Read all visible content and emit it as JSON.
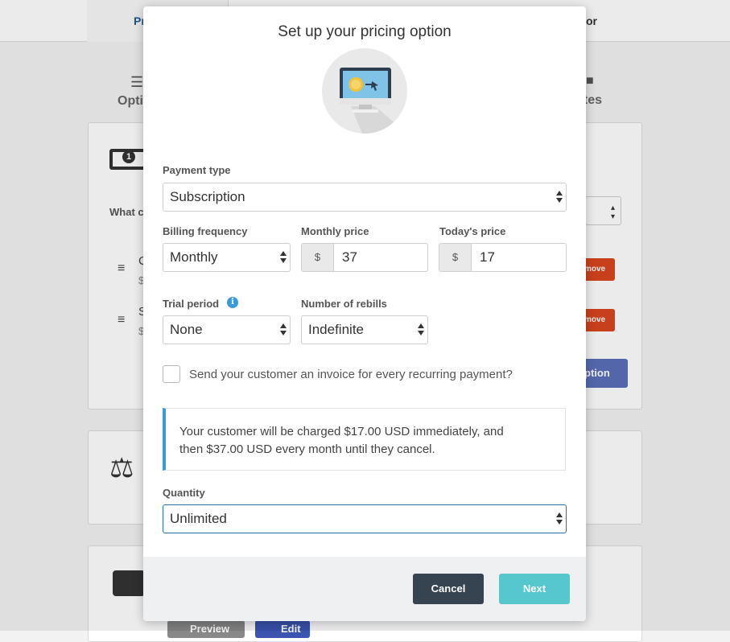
{
  "background": {
    "tab_left": "Pr",
    "tab_right": "or",
    "step_left": "Optio",
    "step_right": "ates",
    "what_text": "What c",
    "row1_letter": "C",
    "row1_price": "$",
    "row2_letter": "S",
    "row2_price": "$",
    "remove_label": "move",
    "add_option_label": "ption",
    "preview_label": "Preview",
    "edit_label": "Edit"
  },
  "modal": {
    "title": "Set up your pricing option",
    "hero_icon": "computer-payment-icon",
    "payment_type": {
      "label": "Payment type",
      "value": "Subscription"
    },
    "billing_frequency": {
      "label": "Billing frequency",
      "value": "Monthly"
    },
    "monthly_price": {
      "label": "Monthly price",
      "currency": "$",
      "value": "37"
    },
    "todays_price": {
      "label": "Today's price",
      "currency": "$",
      "value": "17"
    },
    "trial_period": {
      "label": "Trial period",
      "value": "None",
      "info_icon": "i"
    },
    "rebills": {
      "label": "Number of rebills",
      "value": "Indefinite"
    },
    "invoice_checkbox": {
      "label": "Send your customer an invoice for every recurring payment?",
      "checked": false
    },
    "notice": {
      "line1": "Your customer will be charged $17.00 USD immediately, and",
      "line2": "then $37.00 USD every month until they cancel."
    },
    "quantity": {
      "label": "Quantity",
      "value": "Unlimited"
    },
    "buttons": {
      "cancel": "Cancel",
      "next": "Next"
    },
    "colors": {
      "accent": "#3a9ad9",
      "next": "#56c7cc",
      "cancel": "#364350"
    }
  }
}
